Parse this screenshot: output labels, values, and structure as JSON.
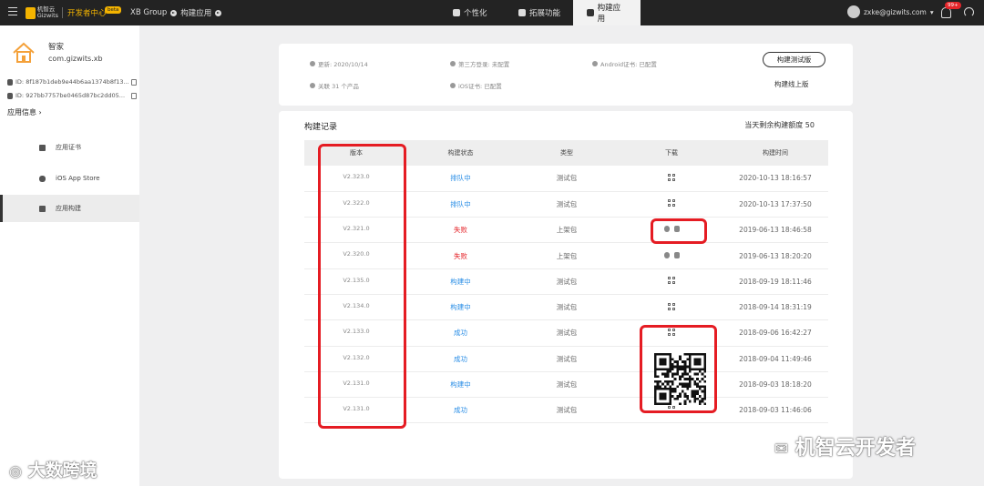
{
  "topbar": {
    "logo_cn": "机智云",
    "logo_en": "Gizwits",
    "dev_center": "开发者中心",
    "beta": "beta",
    "breadcrumb": [
      "XB Group",
      "构建应用"
    ],
    "tabs": [
      {
        "label": "个性化",
        "icon": "palette-icon",
        "active": false
      },
      {
        "label": "拓展功能",
        "icon": "extension-icon",
        "active": false
      },
      {
        "label": "构建应用",
        "icon": "build-icon",
        "active": true
      }
    ],
    "user_email": "zxke@gizwits.com",
    "notification_count": "99+"
  },
  "sidebar": {
    "app_name": "智家",
    "app_package": "com.gizwits.xb",
    "ios_id": "8f187b1deb9e44b6aa1374b8f13...",
    "android_id": "927bb7757be0465d87bc2dd05...",
    "app_info_label": "应用信息",
    "nav": [
      {
        "label": "应用证书",
        "icon": "certificate-icon",
        "active": false
      },
      {
        "label": "iOS App Store",
        "icon": "apple-icon",
        "active": false
      },
      {
        "label": "应用构建",
        "icon": "build-icon",
        "active": true
      }
    ]
  },
  "info": {
    "updated": "更新: 2020/10/14",
    "third_party": "第三方登录: 未配置",
    "android_cert": "Android证书: 已配置",
    "linked": "关联 31 个产品",
    "ios_cert": "iOS证书: 已配置",
    "build_test_label": "构建测试版",
    "build_online_label": "构建线上版"
  },
  "records": {
    "title": "构建记录",
    "quota": "当天剩余构建额度 50",
    "columns": [
      "版本",
      "构建状态",
      "类型",
      "下载",
      "构建时间"
    ],
    "rows": [
      {
        "version": "V2.323.0",
        "status": "排队中",
        "status_kind": "queue",
        "type": "测试包",
        "download": "qr",
        "time": "2020-10-13 18:16:57"
      },
      {
        "version": "V2.322.0",
        "status": "排队中",
        "status_kind": "queue",
        "type": "测试包",
        "download": "qr",
        "time": "2020-10-13 17:37:50"
      },
      {
        "version": "V2.321.0",
        "status": "失败",
        "status_kind": "fail",
        "type": "上架包",
        "download": "platform",
        "time": "2019-06-13 18:46:58"
      },
      {
        "version": "V2.320.0",
        "status": "失败",
        "status_kind": "fail",
        "type": "上架包",
        "download": "platform",
        "time": "2019-06-13 18:20:20"
      },
      {
        "version": "V2.135.0",
        "status": "构建中",
        "status_kind": "building",
        "type": "测试包",
        "download": "qr",
        "time": "2018-09-19 18:11:46"
      },
      {
        "version": "V2.134.0",
        "status": "构建中",
        "status_kind": "building",
        "type": "测试包",
        "download": "qr",
        "time": "2018-09-14 18:31:19"
      },
      {
        "version": "V2.133.0",
        "status": "成功",
        "status_kind": "success",
        "type": "测试包",
        "download": "qr",
        "time": "2018-09-06 16:42:27"
      },
      {
        "version": "V2.132.0",
        "status": "成功",
        "status_kind": "success",
        "type": "测试包",
        "download": "none",
        "time": "2018-09-04 11:49:46"
      },
      {
        "version": "V2.131.0",
        "status": "构建中",
        "status_kind": "building",
        "type": "测试包",
        "download": "none",
        "time": "2018-09-03 18:18:20"
      },
      {
        "version": "V2.131.0",
        "status": "成功",
        "status_kind": "success",
        "type": "测试包",
        "download": "qr",
        "time": "2018-09-03 11:46:06"
      }
    ]
  },
  "colors": {
    "queue": "#2a8ee6",
    "building": "#2a8ee6",
    "success": "#2a8ee6",
    "fail": "#e5262b",
    "highlight": "#e51c23",
    "brand": "#f4b400"
  },
  "watermarks": {
    "left": "大数跨境",
    "right": "机智云开发者"
  }
}
